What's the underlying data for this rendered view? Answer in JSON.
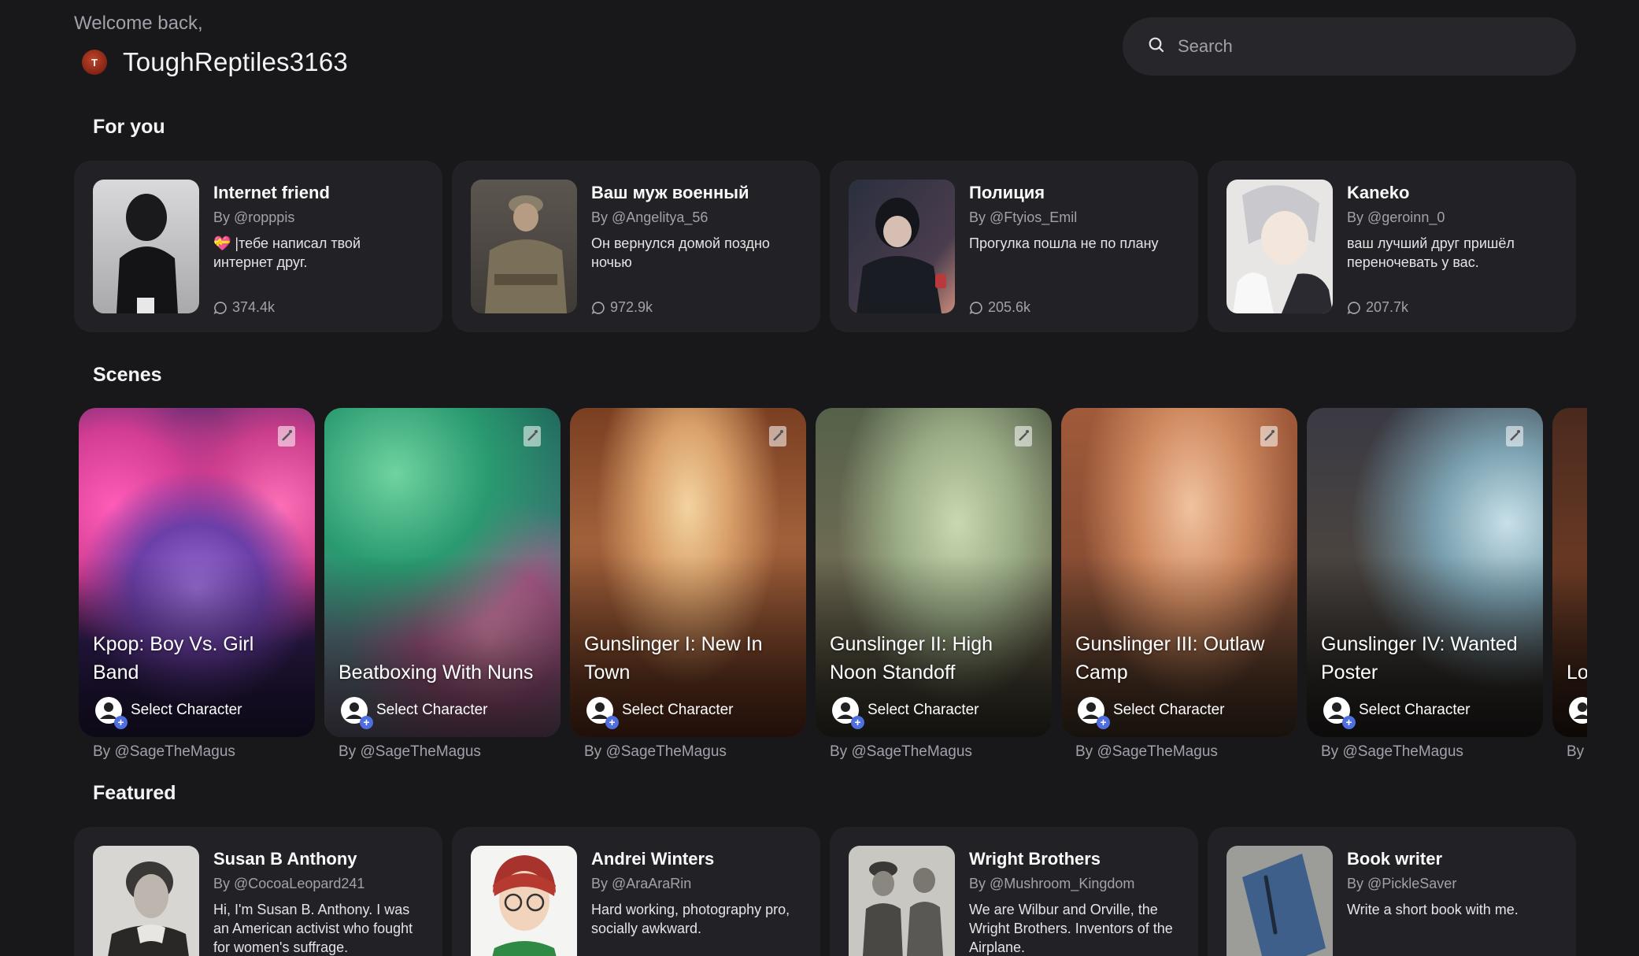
{
  "header": {
    "welcome": "Welcome back,",
    "avatar_initial": "T",
    "username": "ToughReptiles3163",
    "search_placeholder": "Search"
  },
  "sections": {
    "for_you": "For you",
    "scenes": "Scenes",
    "featured": "Featured"
  },
  "for_you": [
    {
      "name": "Internet friend",
      "author": "By @ropppis",
      "description": "💝 |тебе написал твой интернет друг.",
      "chats": "374.4k",
      "icon": "chat-bubble-icon"
    },
    {
      "name": "Ваш муж военный",
      "author": "By @Angelitya_56",
      "description": "Он вернулся домой поздно ночью",
      "chats": "972.9k",
      "icon": "chat-bubble-icon"
    },
    {
      "name": "Полиция",
      "author": "By @Ftyios_Emil",
      "description": "Прогулка пошла не по плану",
      "chats": "205.6k",
      "icon": "chat-bubble-icon"
    },
    {
      "name": "Kaneko",
      "author": "By @geroinn_0",
      "description": "ваш лучший друг пришёл переночевать у вас.",
      "chats": "207.7k",
      "icon": "chat-bubble-icon"
    }
  ],
  "scenes": [
    {
      "title": "Kpop: Boy Vs. Girl Band",
      "select": "Select Character",
      "author": "By @SageTheMagus"
    },
    {
      "title": "Beatboxing With Nuns",
      "select": "Select Character",
      "author": "By @SageTheMagus"
    },
    {
      "title": "Gunslinger I: New In Town",
      "select": "Select Character",
      "author": "By @SageTheMagus"
    },
    {
      "title": "Gunslinger II: High Noon Standoff",
      "select": "Select Character",
      "author": "By @SageTheMagus"
    },
    {
      "title": "Gunslinger III: Outlaw Camp",
      "select": "Select Character",
      "author": "By @SageTheMagus"
    },
    {
      "title": "Gunslinger IV: Wanted Poster",
      "select": "Select Character",
      "author": "By @SageTheMagus"
    },
    {
      "title": "Lo Av",
      "select": "",
      "author": "By"
    }
  ],
  "featured": [
    {
      "name": "Susan B Anthony",
      "author": "By @CocoaLeopard241",
      "description": "Hi, I'm Susan B. Anthony. I was an American activist who fought for women's suffrage."
    },
    {
      "name": "Andrei Winters",
      "author": "By @AraAraRin",
      "description": "Hard working, photography pro, socially awkward."
    },
    {
      "name": "Wright Brothers",
      "author": "By @Mushroom_Kingdom",
      "description": "We are Wilbur and Orville, the Wright Brothers. Inventors of the Airplane."
    },
    {
      "name": "Book writer",
      "author": "By @PickleSaver",
      "description": "Write a short book with me."
    }
  ],
  "colors": {
    "background": "#18181b",
    "card": "#222226",
    "accent_plus": "#4f6fe0",
    "muted_text": "#a1a1aa"
  }
}
